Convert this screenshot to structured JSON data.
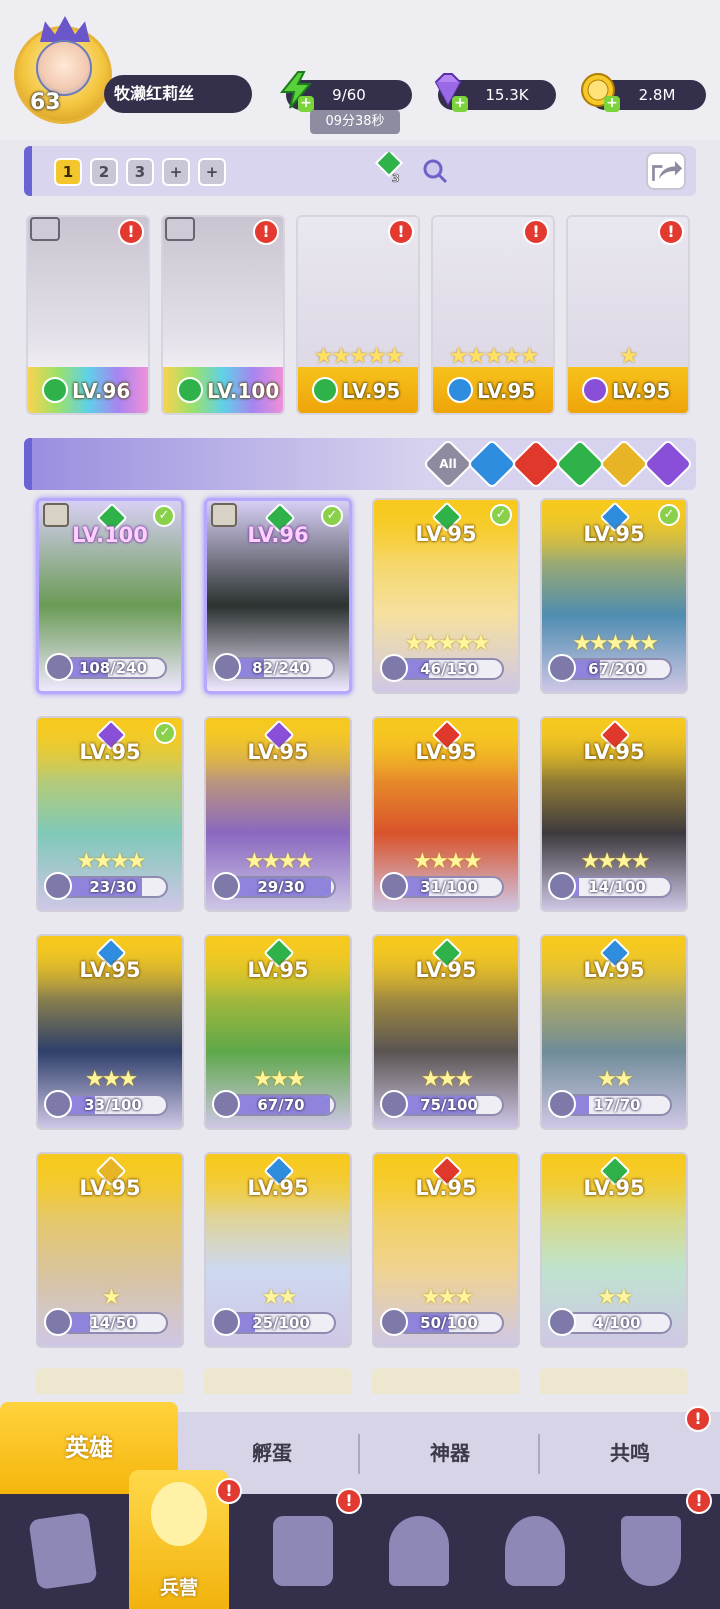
{
  "player": {
    "level": "63",
    "name": "牧濑红莉丝"
  },
  "resources": {
    "stamina": "9/60",
    "stamina_timer": "09分38秒",
    "gems": "15.3K",
    "gold": "2.8M"
  },
  "team_bar": {
    "tabs": [
      "1",
      "2",
      "3",
      "+",
      "+"
    ],
    "active_tab": "1",
    "gem_count": "3"
  },
  "team_slots": [
    {
      "level": "LV.96",
      "element": "wind",
      "alert": "!",
      "stars": "",
      "rarity": "mythic"
    },
    {
      "level": "LV.100",
      "element": "wind",
      "alert": "!",
      "stars": "",
      "rarity": "mythic"
    },
    {
      "level": "LV.95",
      "element": "wind",
      "alert": "!",
      "stars": "★★★★★",
      "rarity": "legend"
    },
    {
      "level": "LV.95",
      "element": "water",
      "alert": "!",
      "stars": "★★★★★",
      "rarity": "legend"
    },
    {
      "level": "LV.95",
      "element": "dark",
      "alert": "!",
      "stars": "★",
      "rarity": "legend"
    }
  ],
  "filters": [
    {
      "name": "all",
      "label": "All",
      "color": "#8e8aa0"
    },
    {
      "name": "water",
      "label": "",
      "color": "#2f8de0"
    },
    {
      "name": "fire",
      "label": "",
      "color": "#e0382b"
    },
    {
      "name": "wind",
      "label": "",
      "color": "#2fb24a"
    },
    {
      "name": "light",
      "label": "",
      "color": "#e6b425"
    },
    {
      "name": "dark",
      "label": "",
      "color": "#8a4fd8"
    }
  ],
  "heroes": [
    {
      "level": "LV.100",
      "progress": "108/240",
      "fraction": 0.45,
      "element": "wind",
      "checked": true,
      "selected": true,
      "stars": "",
      "art": "#6a9b55"
    },
    {
      "level": "LV.96",
      "progress": "82/240",
      "fraction": 0.34,
      "element": "wind",
      "checked": true,
      "selected": true,
      "stars": "",
      "art": "#2b3230"
    },
    {
      "level": "LV.95",
      "progress": "46/150",
      "fraction": 0.31,
      "element": "wind",
      "checked": true,
      "selected": false,
      "stars": "★★★★★",
      "art": "#f5e0a0"
    },
    {
      "level": "LV.95",
      "progress": "67/200",
      "fraction": 0.34,
      "element": "water",
      "checked": true,
      "selected": false,
      "stars": "★★★★★",
      "art": "#4f8db0"
    },
    {
      "level": "LV.95",
      "progress": "23/30",
      "fraction": 0.77,
      "element": "dark",
      "checked": true,
      "selected": false,
      "stars": "★★★★",
      "art": "#7fc9b8"
    },
    {
      "level": "LV.95",
      "progress": "29/30",
      "fraction": 0.97,
      "element": "dark",
      "checked": false,
      "selected": false,
      "stars": "★★★★",
      "art": "#8a68c0"
    },
    {
      "level": "LV.95",
      "progress": "31/100",
      "fraction": 0.31,
      "element": "fire",
      "checked": false,
      "selected": false,
      "stars": "★★★★",
      "art": "#d9532b"
    },
    {
      "level": "LV.95",
      "progress": "14/100",
      "fraction": 0.14,
      "element": "fire",
      "checked": false,
      "selected": false,
      "stars": "★★★★",
      "art": "#3d3a3e"
    },
    {
      "level": "LV.95",
      "progress": "33/100",
      "fraction": 0.33,
      "element": "water",
      "checked": false,
      "selected": false,
      "stars": "★★★",
      "art": "#2e3f6a"
    },
    {
      "level": "LV.95",
      "progress": "67/70",
      "fraction": 0.96,
      "element": "wind",
      "checked": false,
      "selected": false,
      "stars": "★★★",
      "art": "#5ea84a"
    },
    {
      "level": "LV.95",
      "progress": "75/100",
      "fraction": 0.75,
      "element": "wind",
      "checked": false,
      "selected": false,
      "stars": "★★★",
      "art": "#5a5452"
    },
    {
      "level": "LV.95",
      "progress": "17/70",
      "fraction": 0.24,
      "element": "water",
      "checked": false,
      "selected": false,
      "stars": "★★",
      "art": "#6f8c98"
    },
    {
      "level": "LV.95",
      "progress": "14/50",
      "fraction": 0.28,
      "element": "light",
      "checked": false,
      "selected": false,
      "stars": "★",
      "art": "#d9c49a"
    },
    {
      "level": "LV.95",
      "progress": "25/100",
      "fraction": 0.25,
      "element": "water",
      "checked": false,
      "selected": false,
      "stars": "★★",
      "art": "#cdd9f0"
    },
    {
      "level": "LV.95",
      "progress": "50/100",
      "fraction": 0.5,
      "element": "fire",
      "checked": false,
      "selected": false,
      "stars": "★★★",
      "art": "#f0d390"
    },
    {
      "level": "LV.95",
      "progress": "4/100",
      "fraction": 0.04,
      "element": "wind",
      "checked": false,
      "selected": false,
      "stars": "★★",
      "art": "#bfe3cf"
    }
  ],
  "element_colors": {
    "wind": "#2fb24a",
    "water": "#2f8de0",
    "fire": "#e0382b",
    "light": "#e6b425",
    "dark": "#8a4fd8"
  },
  "sub_tabs": {
    "heroes": "英雄",
    "hatch": "孵蛋",
    "artifacts": "神器",
    "resonance": "共鸣",
    "resonance_alert": "!"
  },
  "bottom_nav": {
    "active_label": "兵营",
    "alert": "!"
  }
}
